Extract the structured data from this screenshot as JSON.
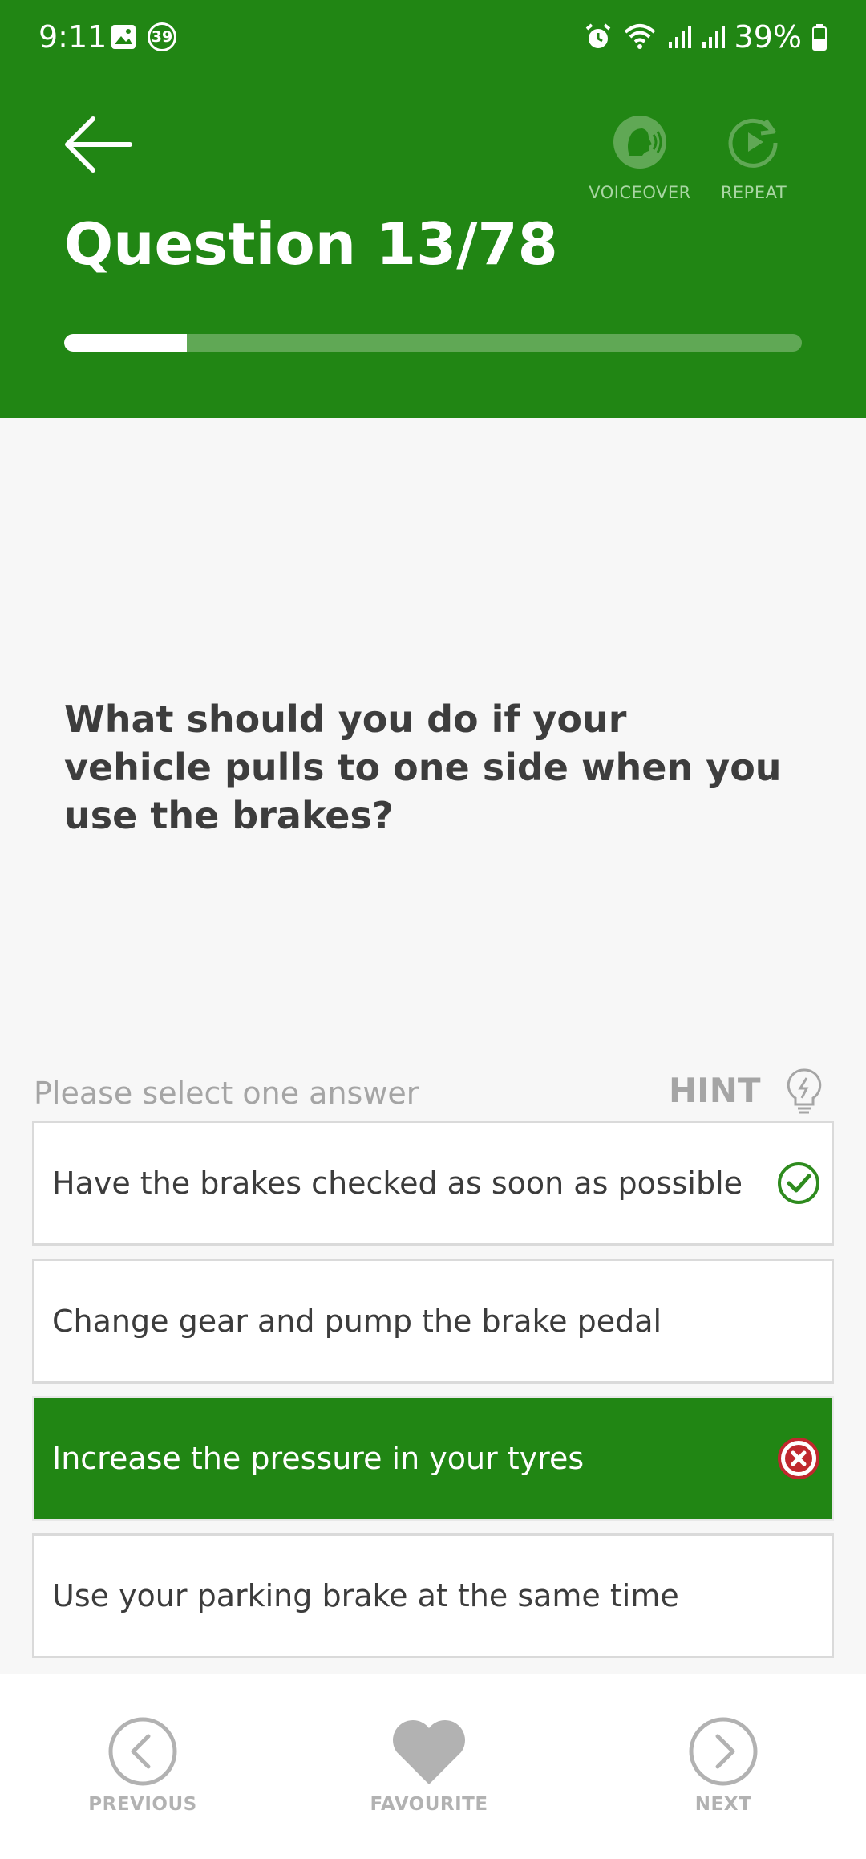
{
  "status_bar": {
    "time": "9:11",
    "notification_count": "39",
    "battery": "39%"
  },
  "header": {
    "voiceover_label": "VOICEOVER",
    "repeat_label": "REPEAT",
    "question_title": "Question 13/78",
    "progress_fraction": 0.1667
  },
  "question": {
    "text": "What should you do if your vehicle pulls to one side when you use the brakes?"
  },
  "answers_header": {
    "prompt": "Please select one answer",
    "hint_label": "HINT"
  },
  "answers": [
    {
      "text": "Have the brakes checked as soon as possible",
      "state": "correct"
    },
    {
      "text": "Change gear and pump the brake pedal",
      "state": "none"
    },
    {
      "text": "Increase the pressure in your tyres",
      "state": "selected-wrong"
    },
    {
      "text": "Use your parking brake at the same time",
      "state": "none"
    }
  ],
  "bottom_nav": {
    "previous_label": "PREVIOUS",
    "favourite_label": "FAVOURITE",
    "next_label": "NEXT"
  },
  "colors": {
    "brand_green": "#218614",
    "correct_green": "#2e8b1e",
    "wrong_red": "#c0282e"
  }
}
